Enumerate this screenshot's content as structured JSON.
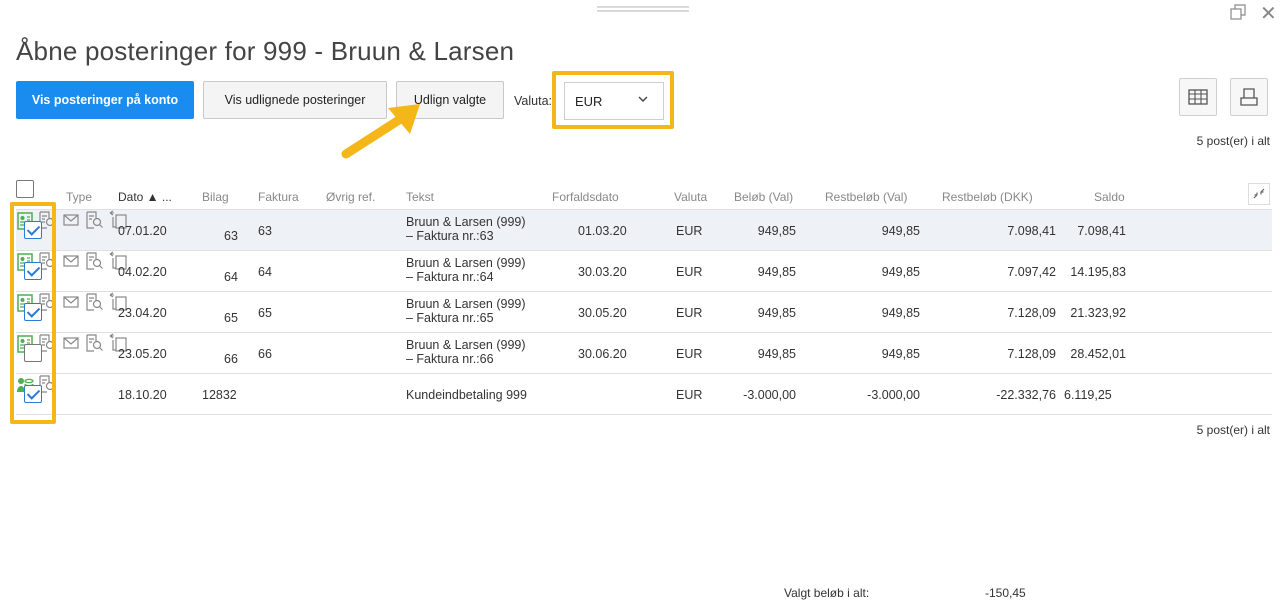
{
  "title": "Åbne posteringer for 999 - Bruun & Larsen",
  "toolbar": {
    "btn_show_account": "Vis posteringer på konto",
    "btn_show_settled": "Vis udlignede posteringer",
    "btn_settle": "Udlign valgte",
    "currency_label": "Valuta:",
    "currency_value": "EUR"
  },
  "count_text": "5 post(er) i alt",
  "columns": {
    "type": "Type",
    "dato": "Dato ▲ ...",
    "bilag": "Bilag",
    "faktura": "Faktura",
    "ovrig": "Øvrig ref.",
    "tekst": "Tekst",
    "forfald": "Forfaldsdato",
    "valuta": "Valuta",
    "belob": "Beløb (Val)",
    "rest_val": "Restbeløb (Val)",
    "rest_dkk": "Restbeløb (DKK)",
    "saldo": "Saldo"
  },
  "rows": [
    {
      "checked": true,
      "type": "invoice",
      "dato": "07.01.20",
      "bilag": "63",
      "faktura": "63",
      "tekst1": "Bruun & Larsen (999)",
      "tekst2": "– Faktura nr.:63",
      "forfald": "01.03.20",
      "valuta": "EUR",
      "belob": "949,85",
      "rest_val": "949,85",
      "rest_dkk": "7.098,41",
      "saldo": "7.098,41"
    },
    {
      "checked": true,
      "type": "invoice",
      "dato": "04.02.20",
      "bilag": "64",
      "faktura": "64",
      "tekst1": "Bruun & Larsen (999)",
      "tekst2": "– Faktura nr.:64",
      "forfald": "30.03.20",
      "valuta": "EUR",
      "belob": "949,85",
      "rest_val": "949,85",
      "rest_dkk": "7.097,42",
      "saldo": "14.195,83"
    },
    {
      "checked": true,
      "type": "invoice",
      "dato": "23.04.20",
      "bilag": "65",
      "faktura": "65",
      "tekst1": "Bruun & Larsen (999)",
      "tekst2": "– Faktura nr.:65",
      "forfald": "30.05.20",
      "valuta": "EUR",
      "belob": "949,85",
      "rest_val": "949,85",
      "rest_dkk": "7.128,09",
      "saldo": "21.323,92"
    },
    {
      "checked": false,
      "type": "invoice",
      "dato": "23.05.20",
      "bilag": "66",
      "faktura": "66",
      "tekst1": "Bruun & Larsen (999)",
      "tekst2": "– Faktura nr.:66",
      "forfald": "30.06.20",
      "valuta": "EUR",
      "belob": "949,85",
      "rest_val": "949,85",
      "rest_dkk": "7.128,09",
      "saldo": "28.452,01"
    },
    {
      "checked": true,
      "type": "payment",
      "dato": "18.10.20",
      "bilag_text": "12832",
      "tekst": "Kundeindbetaling 999",
      "valuta": "EUR",
      "belob": "-3.000,00",
      "rest_val": "-3.000,00",
      "rest_dkk": "-22.332,76",
      "saldo": "6.119,25"
    }
  ],
  "footer": {
    "selected_label": "Valgt beløb i alt:",
    "selected_value": "-150,45"
  },
  "colors": {
    "primary": "#1a8cf0",
    "highlight": "#f5b619",
    "type_icon": "#4caf50"
  }
}
